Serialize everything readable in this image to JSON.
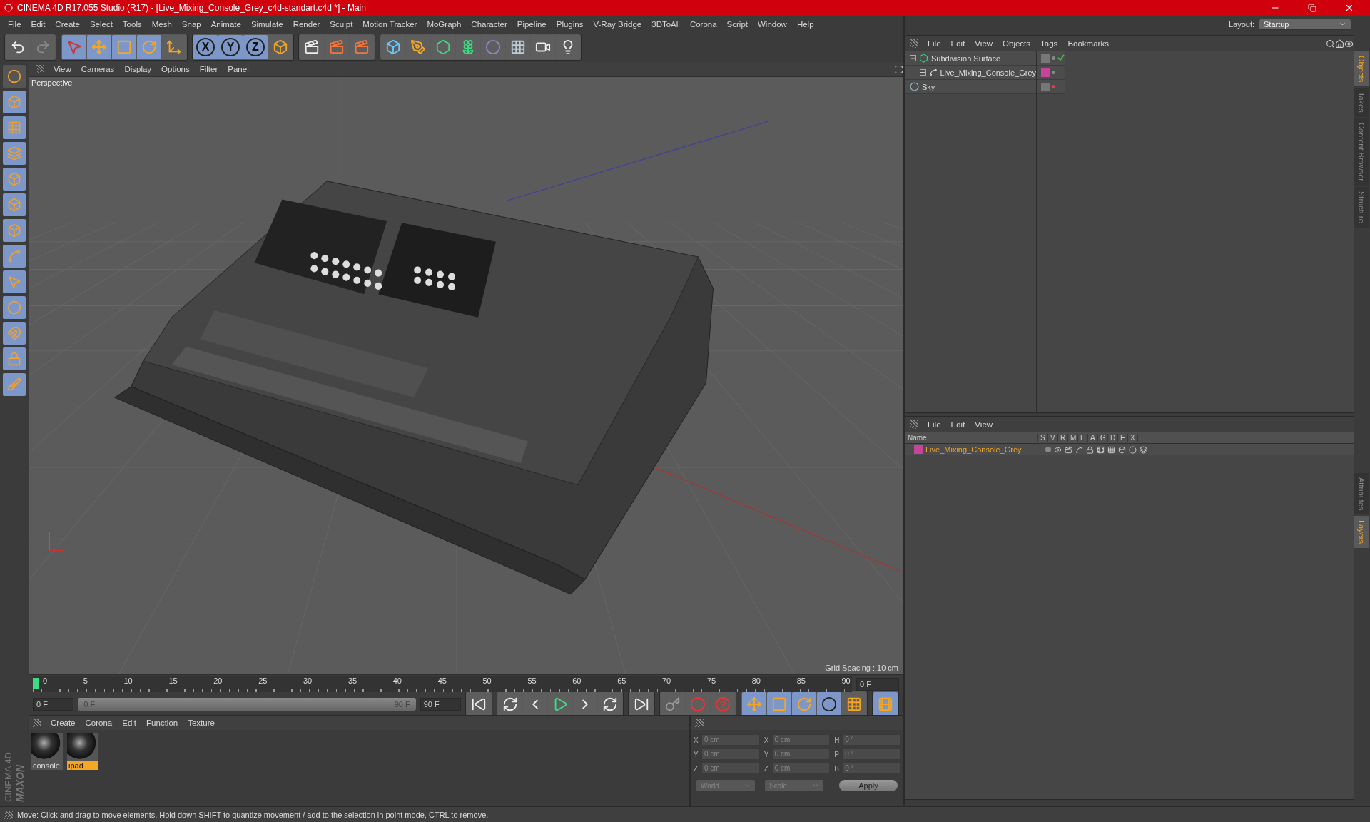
{
  "window": {
    "title": "CINEMA 4D R17.055 Studio (R17) - [Live_Mixing_Console_Grey_c4d-standart.c4d *] - Main"
  },
  "menu": [
    "File",
    "Edit",
    "Create",
    "Select",
    "Tools",
    "Mesh",
    "Snap",
    "Animate",
    "Simulate",
    "Render",
    "Sculpt",
    "Motion Tracker",
    "MoGraph",
    "Character",
    "Pipeline",
    "Plugins",
    "V-Ray Bridge",
    "3DToAll",
    "Corona",
    "Script",
    "Window",
    "Help"
  ],
  "layout": {
    "label": "Layout:",
    "value": "Startup"
  },
  "toolbar": {
    "axes": [
      "X",
      "Y",
      "Z"
    ]
  },
  "viewport": {
    "menu": [
      "View",
      "Cameras",
      "Display",
      "Options",
      "Filter",
      "Panel"
    ],
    "camera": "Perspective",
    "grid_spacing": "Grid Spacing : 10 cm"
  },
  "object_manager": {
    "menu": [
      "File",
      "Edit",
      "View",
      "Objects",
      "Tags",
      "Bookmarks"
    ],
    "objects": [
      {
        "name": "Subdivision Surface",
        "kind": "generator",
        "expanded": true,
        "check": true,
        "render_visible": true,
        "children": [
          {
            "name": "Live_Mixing_Console_Grey",
            "kind": "null",
            "expanded": false,
            "check": false,
            "render_visible": true,
            "color": "#c8449a"
          }
        ]
      },
      {
        "name": "Sky",
        "kind": "sky",
        "check": false,
        "render_visible": false
      }
    ]
  },
  "layer_manager": {
    "menu": [
      "File",
      "Edit",
      "View"
    ],
    "columns": [
      "Name",
      "S",
      "V",
      "R",
      "M",
      "L",
      "A",
      "G",
      "D",
      "E",
      "X"
    ],
    "layers": [
      {
        "name": "Live_Mixing_Console_Grey",
        "color": "#c8449a"
      }
    ]
  },
  "side_tabs_top": [
    {
      "label": "Objects",
      "selected": true
    },
    {
      "label": "Takes",
      "selected": false
    },
    {
      "label": "Content Browser",
      "selected": false
    },
    {
      "label": "Structure",
      "selected": false
    }
  ],
  "side_tabs_bottom": [
    {
      "label": "Attributes",
      "selected": false
    },
    {
      "label": "Layers",
      "selected": true
    }
  ],
  "timeline": {
    "ticks": [
      "0",
      "5",
      "10",
      "15",
      "20",
      "25",
      "30",
      "35",
      "40",
      "45",
      "50",
      "55",
      "60",
      "65",
      "70",
      "75",
      "80",
      "85",
      "90"
    ],
    "current_frame": "0 F",
    "start": "0 F",
    "range_start": "0 F",
    "range_end": "90 F",
    "end": "90 F",
    "level": 1
  },
  "material_manager": {
    "menu": [
      "Create",
      "Corona",
      "Edit",
      "Function",
      "Texture"
    ],
    "materials": [
      {
        "name": "console",
        "selected": false
      },
      {
        "name": "ipad",
        "selected": true
      }
    ]
  },
  "coordinates": {
    "headers": [
      "--",
      "--",
      "--"
    ],
    "rows": [
      [
        {
          "axis": "X",
          "value": "0 cm"
        },
        {
          "axis": "X",
          "value": "0 cm"
        },
        {
          "axis": "H",
          "value": "0 °"
        }
      ],
      [
        {
          "axis": "Y",
          "value": "0 cm"
        },
        {
          "axis": "Y",
          "value": "0 cm"
        },
        {
          "axis": "P",
          "value": "0 °"
        }
      ],
      [
        {
          "axis": "Z",
          "value": "0 cm"
        },
        {
          "axis": "Z",
          "value": "0 cm"
        },
        {
          "axis": "B",
          "value": "0 °"
        }
      ]
    ],
    "mode": "World",
    "transform": "Scale",
    "apply": "Apply"
  },
  "brand": {
    "maker": "MAXON",
    "product": "CINEMA 4D"
  },
  "status": "Move: Click and drag to move elements. Hold down SHIFT to quantize movement / add to the selection in point mode, CTRL to remove."
}
